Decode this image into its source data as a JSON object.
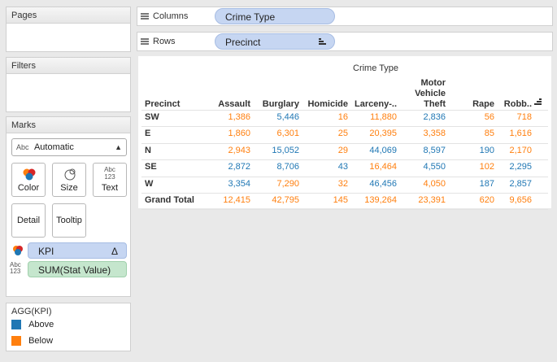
{
  "pages": {
    "title": "Pages"
  },
  "filters": {
    "title": "Filters"
  },
  "marks": {
    "title": "Marks",
    "mark_type": "Automatic",
    "mark_type_prefix": "Abc",
    "buttons": {
      "color": "Color",
      "size": "Size",
      "text": "Text",
      "detail": "Detail",
      "tooltip": "Tooltip"
    },
    "text_icon_top": "Abc",
    "text_icon_bottom": "123",
    "fields": [
      {
        "label": "KPI",
        "suffix": "Δ"
      },
      {
        "label": "SUM(Stat Value)"
      }
    ]
  },
  "legend": {
    "title": "AGG(KPI)",
    "items": [
      {
        "label": "Above",
        "color": "#1f77b4"
      },
      {
        "label": "Below",
        "color": "#ff7f0e"
      }
    ]
  },
  "shelves": {
    "columns": {
      "label": "Columns",
      "pill": "Crime Type"
    },
    "rows": {
      "label": "Rows",
      "pill": "Precinct"
    }
  },
  "table": {
    "column_group": "Crime Type",
    "row_header": "Precinct",
    "columns": [
      "Assault",
      "Burglary",
      "Homicide",
      "Larceny-..",
      "Motor Vehicle Theft",
      "Rape",
      "Robb.."
    ],
    "motor_vehicle_lines": [
      "Motor",
      "Vehicle",
      "Theft"
    ],
    "rows": [
      {
        "precinct": "SW",
        "cells": [
          {
            "v": "1,386",
            "kpi": "Below"
          },
          {
            "v": "5,446",
            "kpi": "Above"
          },
          {
            "v": "16",
            "kpi": "Below"
          },
          {
            "v": "11,880",
            "kpi": "Below"
          },
          {
            "v": "2,836",
            "kpi": "Above"
          },
          {
            "v": "56",
            "kpi": "Below"
          },
          {
            "v": "718",
            "kpi": "Below"
          }
        ]
      },
      {
        "precinct": "E",
        "cells": [
          {
            "v": "1,860",
            "kpi": "Below"
          },
          {
            "v": "6,301",
            "kpi": "Below"
          },
          {
            "v": "25",
            "kpi": "Below"
          },
          {
            "v": "20,395",
            "kpi": "Below"
          },
          {
            "v": "3,358",
            "kpi": "Below"
          },
          {
            "v": "85",
            "kpi": "Below"
          },
          {
            "v": "1,616",
            "kpi": "Below"
          }
        ]
      },
      {
        "precinct": "N",
        "cells": [
          {
            "v": "2,943",
            "kpi": "Below"
          },
          {
            "v": "15,052",
            "kpi": "Above"
          },
          {
            "v": "29",
            "kpi": "Below"
          },
          {
            "v": "44,069",
            "kpi": "Above"
          },
          {
            "v": "8,597",
            "kpi": "Above"
          },
          {
            "v": "190",
            "kpi": "Above"
          },
          {
            "v": "2,170",
            "kpi": "Below"
          }
        ]
      },
      {
        "precinct": "SE",
        "cells": [
          {
            "v": "2,872",
            "kpi": "Above"
          },
          {
            "v": "8,706",
            "kpi": "Above"
          },
          {
            "v": "43",
            "kpi": "Above"
          },
          {
            "v": "16,464",
            "kpi": "Below"
          },
          {
            "v": "4,550",
            "kpi": "Above"
          },
          {
            "v": "102",
            "kpi": "Below"
          },
          {
            "v": "2,295",
            "kpi": "Above"
          }
        ]
      },
      {
        "precinct": "W",
        "cells": [
          {
            "v": "3,354",
            "kpi": "Above"
          },
          {
            "v": "7,290",
            "kpi": "Below"
          },
          {
            "v": "32",
            "kpi": "Below"
          },
          {
            "v": "46,456",
            "kpi": "Above"
          },
          {
            "v": "4,050",
            "kpi": "Below"
          },
          {
            "v": "187",
            "kpi": "Above"
          },
          {
            "v": "2,857",
            "kpi": "Above"
          }
        ]
      }
    ],
    "grand_total": {
      "label": "Grand Total",
      "cells": [
        {
          "v": "12,415",
          "kpi": "Below"
        },
        {
          "v": "42,795",
          "kpi": "Below"
        },
        {
          "v": "145",
          "kpi": "Below"
        },
        {
          "v": "139,264",
          "kpi": "Below"
        },
        {
          "v": "23,391",
          "kpi": "Below"
        },
        {
          "v": "620",
          "kpi": "Below"
        },
        {
          "v": "9,656",
          "kpi": "Below"
        }
      ]
    }
  }
}
